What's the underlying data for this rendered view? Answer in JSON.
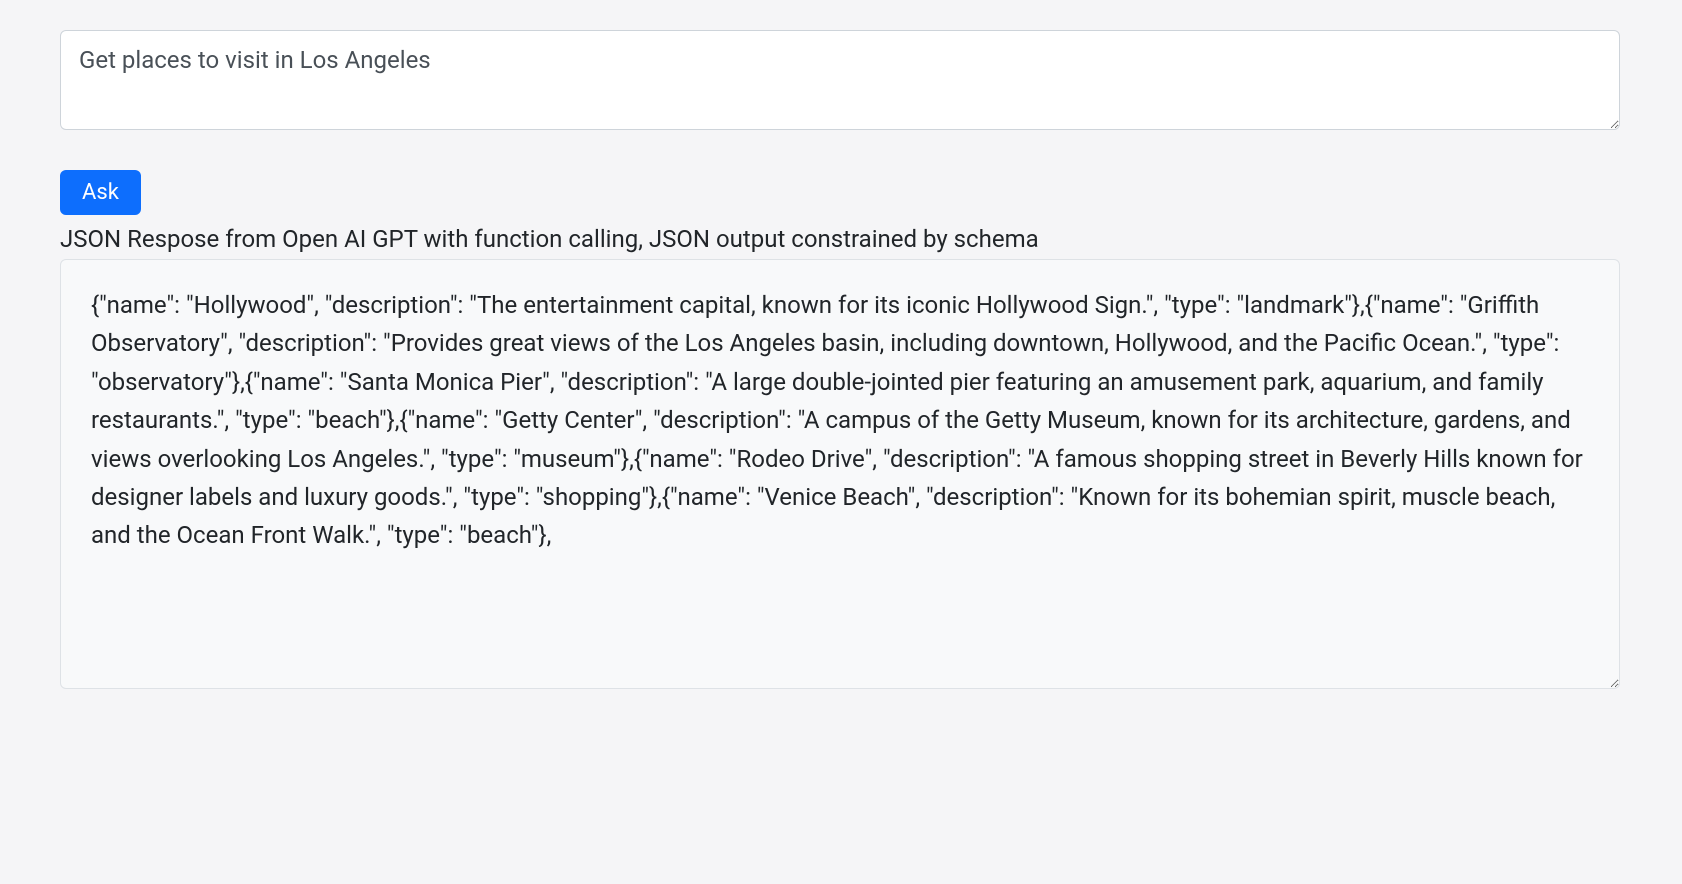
{
  "query": {
    "value": "Get places to visit in Los Angeles"
  },
  "button": {
    "ask_label": "Ask"
  },
  "response": {
    "label": "JSON Respose from Open AI GPT with function calling, JSON output constrained by schema",
    "content": "{\"name\": \"Hollywood\", \"description\": \"The entertainment capital, known for its iconic Hollywood Sign.\", \"type\": \"landmark\"},{\"name\": \"Griffith Observatory\", \"description\": \"Provides great views of the Los Angeles basin, including downtown, Hollywood, and the Pacific Ocean.\", \"type\": \"observatory\"},{\"name\": \"Santa Monica Pier\", \"description\": \"A large double-jointed pier featuring an amusement park, aquarium, and family restaurants.\", \"type\": \"beach\"},{\"name\": \"Getty Center\", \"description\": \"A campus of the Getty Museum, known for its architecture, gardens, and views overlooking Los Angeles.\", \"type\": \"museum\"},{\"name\": \"Rodeo Drive\", \"description\": \"A famous shopping street in Beverly Hills known for designer labels and luxury goods.\", \"type\": \"shopping\"},{\"name\": \"Venice Beach\", \"description\": \"Known for its bohemian spirit, muscle beach, and the Ocean Front Walk.\", \"type\": \"beach\"},"
  }
}
